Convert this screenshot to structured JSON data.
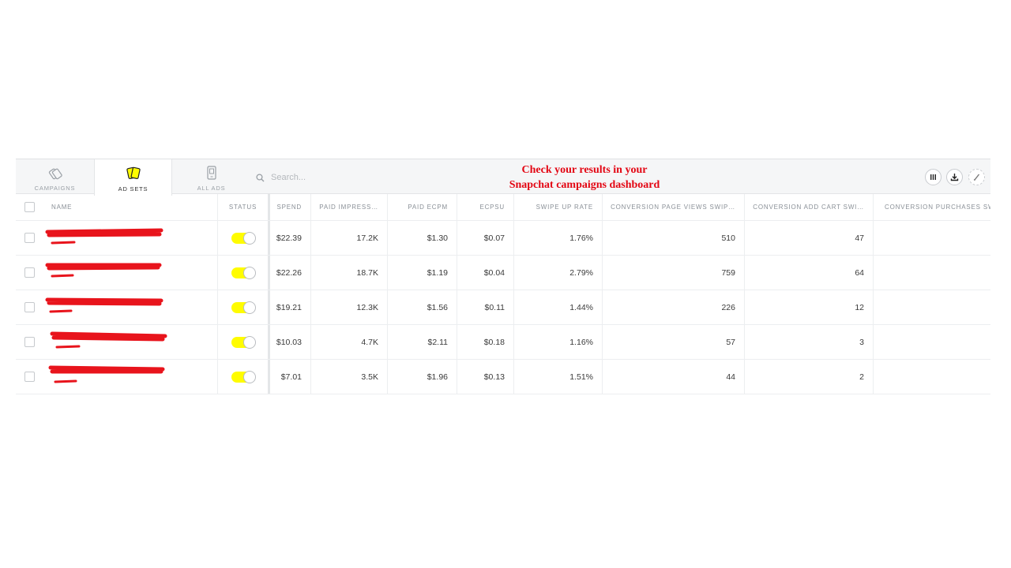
{
  "tabs": [
    {
      "label": "CAMPAIGNS",
      "icon": "campaigns-icon",
      "active": false
    },
    {
      "label": "AD SETS",
      "icon": "ad-sets-icon",
      "active": true
    },
    {
      "label": "ALL ADS",
      "icon": "phone-icon",
      "active": false
    }
  ],
  "search": {
    "placeholder": "Search..."
  },
  "overlay": {
    "line1": "Check your results in your",
    "line2": "Snapchat campaigns dashboard"
  },
  "toolbar": {
    "icons": [
      "columns-icon",
      "download-icon",
      "edit-icon"
    ]
  },
  "colors": {
    "accent": "#fffc00",
    "overlay_text": "#e30613",
    "redaction": "#e8141c"
  },
  "table": {
    "headers": {
      "name": "NAME",
      "status": "STATUS",
      "spend": "SPEND",
      "imp": "PAID IMPRESS…",
      "ecpm": "PAID ECPM",
      "ecpsu": "ECPSU",
      "swipe": "SWIPE UP RATE",
      "cpv": "CONVERSION PAGE VIEWS SWIP…",
      "cac": "CONVERSION ADD CART SWI…",
      "cp": "CONVERSION PURCHASES SW"
    },
    "rows": [
      {
        "spend": "$22.39",
        "imp": "17.2K",
        "ecpm": "$1.30",
        "ecpsu": "$0.07",
        "swipe": "1.76%",
        "cpv": "510",
        "cac": "47",
        "cp": ""
      },
      {
        "spend": "$22.26",
        "imp": "18.7K",
        "ecpm": "$1.19",
        "ecpsu": "$0.04",
        "swipe": "2.79%",
        "cpv": "759",
        "cac": "64",
        "cp": ""
      },
      {
        "spend": "$19.21",
        "imp": "12.3K",
        "ecpm": "$1.56",
        "ecpsu": "$0.11",
        "swipe": "1.44%",
        "cpv": "226",
        "cac": "12",
        "cp": ""
      },
      {
        "spend": "$10.03",
        "imp": "4.7K",
        "ecpm": "$2.11",
        "ecpsu": "$0.18",
        "swipe": "1.16%",
        "cpv": "57",
        "cac": "3",
        "cp": ""
      },
      {
        "spend": "$7.01",
        "imp": "3.5K",
        "ecpm": "$1.96",
        "ecpsu": "$0.13",
        "swipe": "1.51%",
        "cpv": "44",
        "cac": "2",
        "cp": ""
      }
    ]
  }
}
